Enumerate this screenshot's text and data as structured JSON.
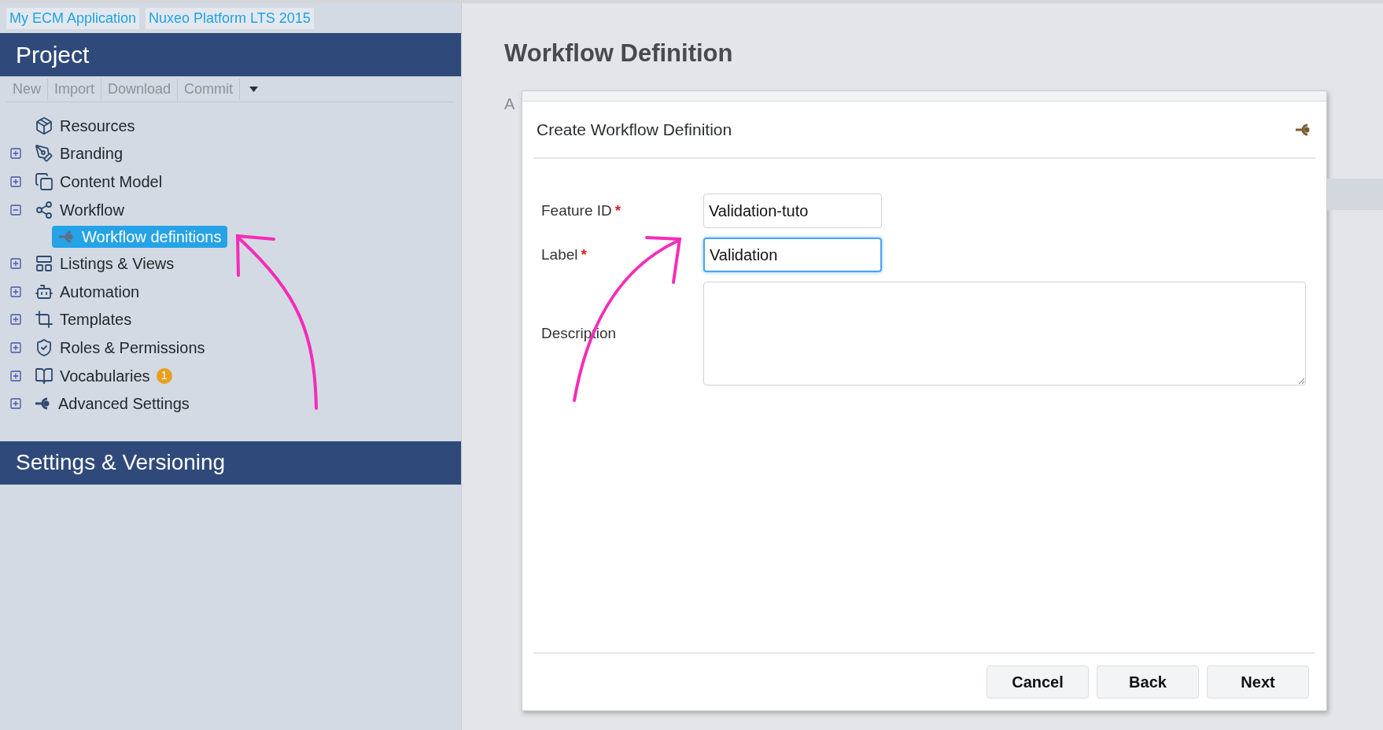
{
  "breadcrumbs": [
    "My ECM Application",
    "Nuxeo Platform LTS 2015"
  ],
  "sidebar": {
    "title": "Project",
    "toolbar": [
      "New",
      "Import",
      "Download",
      "Commit"
    ],
    "tree": [
      {
        "label": "Resources",
        "selected": false
      },
      {
        "label": "Branding",
        "expanded": false,
        "selected": false
      },
      {
        "label": "Content Model",
        "expanded": false,
        "selected": false
      },
      {
        "label": "Workflow",
        "expanded": true,
        "selected": false,
        "children": [
          {
            "label": "Workflow definitions",
            "selected": true
          }
        ]
      },
      {
        "label": "Listings & Views",
        "expanded": false,
        "selected": false
      },
      {
        "label": "Automation",
        "expanded": false,
        "selected": false
      },
      {
        "label": "Templates",
        "expanded": false,
        "selected": false
      },
      {
        "label": "Roles & Permissions",
        "expanded": false,
        "selected": false
      },
      {
        "label": "Vocabularies",
        "expanded": false,
        "selected": false,
        "badge": "1"
      },
      {
        "label": "Advanced Settings",
        "expanded": false,
        "selected": false
      }
    ],
    "section": "Settings & Versioning"
  },
  "main": {
    "title": "Workflow Definition",
    "partial_text": "A"
  },
  "dialog": {
    "title": "Create Workflow Definition",
    "fields": [
      {
        "kind": "text",
        "label": "Feature ID",
        "required_mark": "*",
        "value": "Validation-tuto",
        "focused": false
      },
      {
        "kind": "text",
        "label": "Label",
        "required_mark": "*",
        "value": "Validation",
        "focused": true
      },
      {
        "kind": "textarea",
        "label": "Description",
        "focused": false
      }
    ],
    "buttons": [
      "Cancel",
      "Back",
      "Next"
    ]
  }
}
